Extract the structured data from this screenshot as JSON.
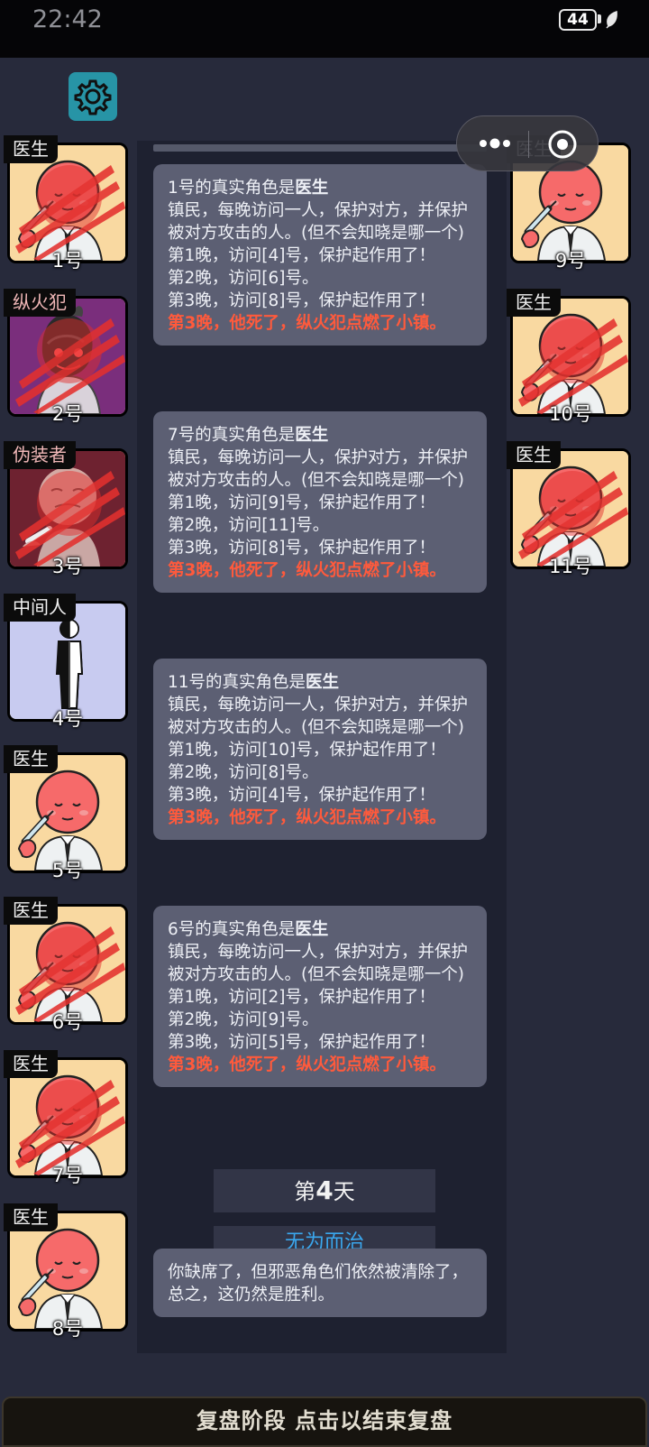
{
  "status": {
    "time": "22:42",
    "battery": "44"
  },
  "players_left": [
    {
      "role": "医生",
      "num": "1号",
      "art": "doctor",
      "dead": true
    },
    {
      "role": "纵火犯",
      "num": "2号",
      "art": "arsonist",
      "dead": true
    },
    {
      "role": "伪装者",
      "num": "3号",
      "art": "disguiser",
      "dead": true
    },
    {
      "role": "中间人",
      "num": "4号",
      "art": "middleman",
      "dead": false
    },
    {
      "role": "医生",
      "num": "5号",
      "art": "doctor",
      "dead": false
    },
    {
      "role": "医生",
      "num": "6号",
      "art": "doctor",
      "dead": true
    },
    {
      "role": "医生",
      "num": "7号",
      "art": "doctor",
      "dead": true
    },
    {
      "role": "医生",
      "num": "8号",
      "art": "doctor",
      "dead": false
    }
  ],
  "players_right": [
    {
      "role": "医生",
      "num": "9号",
      "art": "doctor",
      "dead": false
    },
    {
      "role": "医生",
      "num": "10号",
      "art": "doctor",
      "dead": true
    },
    {
      "role": "医生",
      "num": "11号",
      "art": "doctor",
      "dead": true
    }
  ],
  "messages": [
    {
      "intro": "1号的真实角色是",
      "role": "医生",
      "desc": "镇民，每晚访问一人，保护对方，并保护被对方攻击的人。(但不会知晓是哪一个)",
      "nights": [
        "第1晚，访问[4]号，保护起作用了！",
        "第2晚，访问[6]号。",
        "第3晚，访问[8]号，保护起作用了！"
      ],
      "death": "第3晚，他死了，纵火犯点燃了小镇。"
    },
    {
      "intro": "7号的真实角色是",
      "role": "医生",
      "desc": "镇民，每晚访问一人，保护对方，并保护被对方攻击的人。(但不会知晓是哪一个)",
      "nights": [
        "第1晚，访问[9]号，保护起作用了！",
        "第2晚，访问[11]号。",
        "第3晚，访问[8]号，保护起作用了！"
      ],
      "death": "第3晚，他死了，纵火犯点燃了小镇。"
    },
    {
      "intro": "11号的真实角色是",
      "role": "医生",
      "desc": "镇民，每晚访问一人，保护对方，并保护被对方攻击的人。(但不会知晓是哪一个)",
      "nights": [
        "第1晚，访问[10]号，保护起作用了！",
        "第2晚，访问[8]号。",
        "第3晚，访问[4]号，保护起作用了！"
      ],
      "death": "第3晚，他死了，纵火犯点燃了小镇。"
    },
    {
      "intro": "6号的真实角色是",
      "role": "医生",
      "desc": "镇民，每晚访问一人，保护对方，并保护被对方攻击的人。(但不会知晓是哪一个)",
      "nights": [
        "第1晚，访问[2]号，保护起作用了！",
        "第2晚，访问[9]号。",
        "第3晚，访问[5]号，保护起作用了！"
      ],
      "death": "第3晚，他死了，纵火犯点燃了小镇。"
    }
  ],
  "day": {
    "prefix": "第",
    "number": "4",
    "suffix": "天"
  },
  "event": "无为而治",
  "summary": "你缺席了，但邪恶角色们依然被清除了，总之，这仍然是胜利。",
  "footer": "复盘阶段 点击以结束复盘",
  "colors": {
    "accent_settings": "#2794a6",
    "death_text": "#ff5a3c",
    "event_text": "#3aa7ee",
    "card_bg": "#f9d9a1"
  }
}
